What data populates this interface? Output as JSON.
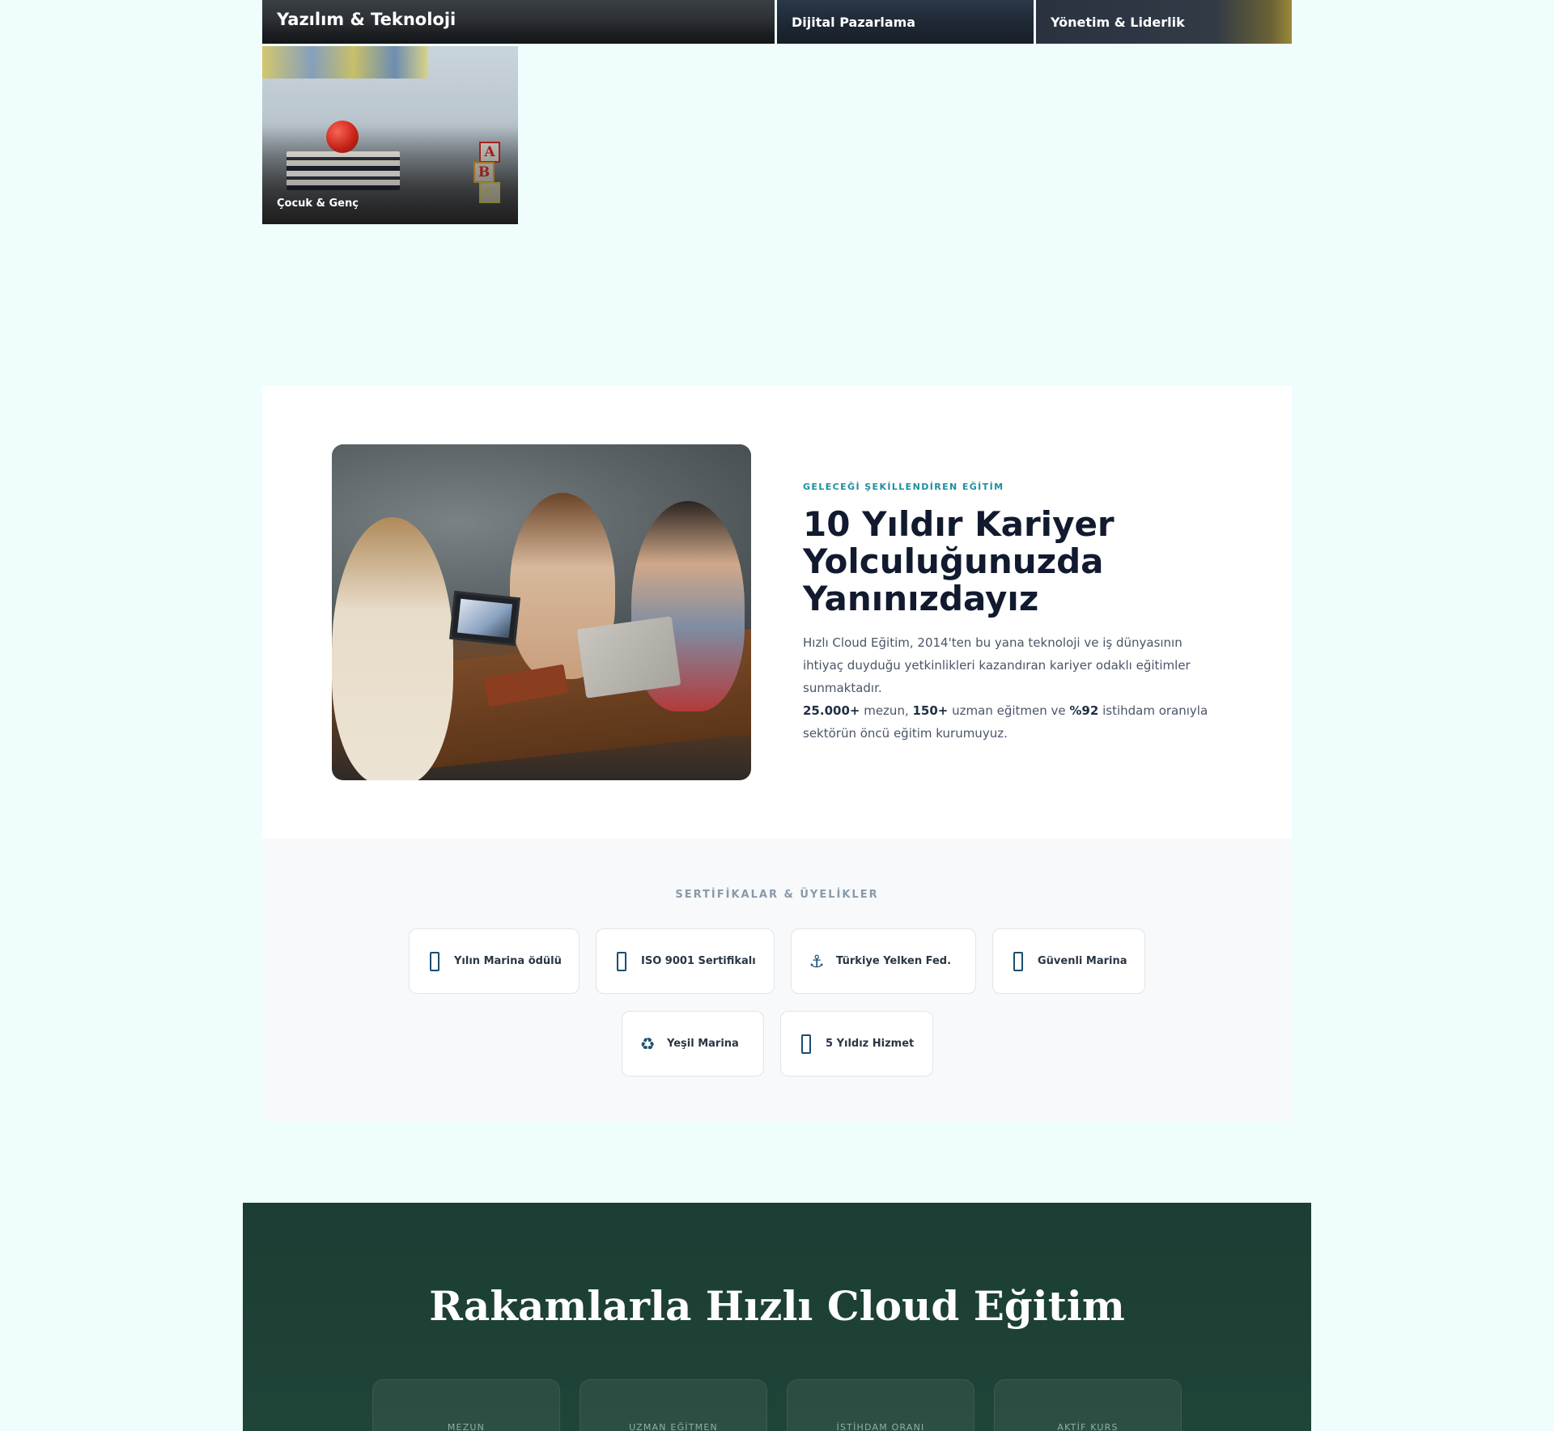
{
  "categories": [
    {
      "label": "Yazılım & Teknoloji"
    },
    {
      "label": "Dijital Pazarlama"
    },
    {
      "label": "Yönetim & Liderlik"
    },
    {
      "label": "Çocuk & Genç"
    }
  ],
  "about": {
    "eyebrow": "GELECEĞİ ŞEKİLLENDİREN EĞİTİM",
    "title": "10 Yıldır Kariyer Yolculuğunuzda Yanınızdayız",
    "paragraph1": "Hızlı Cloud Eğitim, 2014'ten bu yana teknoloji ve iş dünyasının ihtiyaç duyduğu yetkinlikleri kazandıran kariyer odaklı eğitimler sunmaktadır.",
    "stat_graduates": "25.000+",
    "text_graduates": " mezun, ",
    "stat_trainers": "150+",
    "text_trainers": " uzman eğitmen ve ",
    "stat_employment": "%92",
    "text_employment": " istihdam oranıyla sektörün öncü eğitim kurumuyuz."
  },
  "certificates": {
    "title": "SERTİFİKALAR & ÜYELİKLER",
    "items": [
      {
        "label": "Yılın Marina ödülü",
        "icon": "award-icon"
      },
      {
        "label": "ISO 9001 Sertifikalı",
        "icon": "certificate-icon"
      },
      {
        "label": "Türkiye Yelken Fed.",
        "icon": "anchor-icon",
        "glyph": "⚓"
      },
      {
        "label": "Güvenli Marina",
        "icon": "shield-icon"
      },
      {
        "label": "Yeşil Marina",
        "icon": "recycle-icon",
        "glyph": "♻"
      },
      {
        "label": "5 Yıldız Hizmet",
        "icon": "star-icon"
      }
    ]
  },
  "stats": {
    "title": "Rakamlarla Hızlı Cloud Eğitim",
    "cards": [
      {
        "label": "MEZUN"
      },
      {
        "label": "UZMAN EĞİTMEN"
      },
      {
        "label": "İSTİHDAM ORANI"
      },
      {
        "label": "AKTİF KURS"
      }
    ]
  },
  "colors": {
    "page_bg": "#effdfd",
    "accent": "#1b8fa0",
    "heading": "#111a2e",
    "stats_bg": "#1c3d33"
  }
}
